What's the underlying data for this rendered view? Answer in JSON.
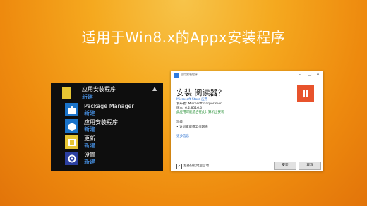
{
  "headline": "适用于Win8.x的Appx安装程序",
  "start_menu": {
    "group_title": "应用安装程序",
    "group_subtitle": "新建",
    "items": [
      {
        "label": "Package Manager",
        "sub": "新建",
        "icon": "package-icon",
        "color": "#1a73c9"
      },
      {
        "label": "应用安装程序",
        "sub": "新建",
        "icon": "box-icon",
        "color": "#1a73c9"
      },
      {
        "label": "更新",
        "sub": "新建",
        "icon": "update-icon",
        "color": "#e6c533"
      },
      {
        "label": "设置",
        "sub": "新建",
        "icon": "gear-icon",
        "color": "#2b3fa0"
      }
    ]
  },
  "dialog": {
    "window_title": "应用安装程序",
    "title": "安装 阅读器？",
    "app_source": "Microsoft Store 应用",
    "publisher": "发布者: Microsoft Corporation",
    "version": "版本: 6.2.8516.0",
    "compat_note": "此应用可能适合在此计算机上安装",
    "capabilities_label": "功能:",
    "capability_1": "• 访问家庭或工作网络",
    "more_info": "更多信息",
    "launch_when_ready": "准备好就绪后启动",
    "install_button": "安装",
    "cancel_button": "取消"
  },
  "colors": {
    "accent": "#2a6fd0",
    "logo": "#e8532c",
    "menu_bg": "#0e0e0e"
  }
}
